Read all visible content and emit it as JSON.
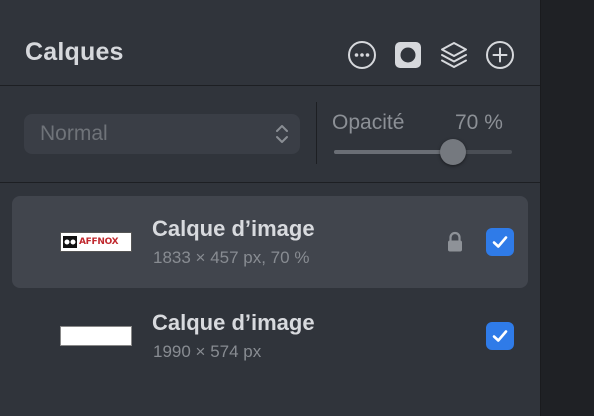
{
  "panel": {
    "title": "Calques"
  },
  "header_icons": [
    "more-options-icon",
    "mask-icon",
    "layers-icon",
    "add-icon"
  ],
  "blend_mode": {
    "value": "Normal"
  },
  "opacity": {
    "label": "Opacité",
    "value_text": "70 %",
    "value": 0.7
  },
  "layers": [
    {
      "name": "Calque d’image",
      "meta": "1833 × 457 px, 70 %",
      "thumbnail_text": "AFFNOX",
      "locked": true,
      "visible": true,
      "selected": true
    },
    {
      "name": "Calque d’image",
      "meta": "1990 × 574 px",
      "locked": false,
      "visible": true,
      "selected": false
    }
  ],
  "colors": {
    "panel_bg": "#30343b",
    "selected_row": "#41454d",
    "checkbox_accent": "#2f7be8"
  }
}
